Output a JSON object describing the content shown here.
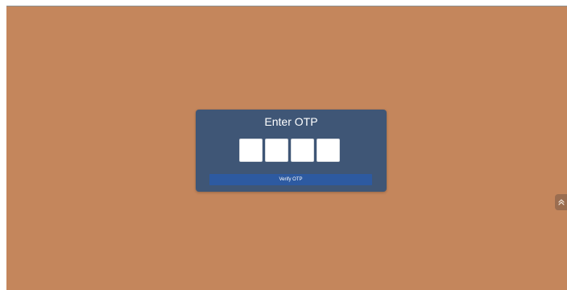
{
  "otp": {
    "title": "Enter OTP",
    "digits": [
      "",
      "",
      "",
      ""
    ],
    "verify_label": "Verify OTP"
  },
  "icons": {
    "edge_handle": "expand-chevron-icon"
  },
  "colors": {
    "background": "#c4865c",
    "card": "#3f5676",
    "button": "#2d5aa1",
    "input": "#ffffff",
    "text": "#ffffff"
  }
}
